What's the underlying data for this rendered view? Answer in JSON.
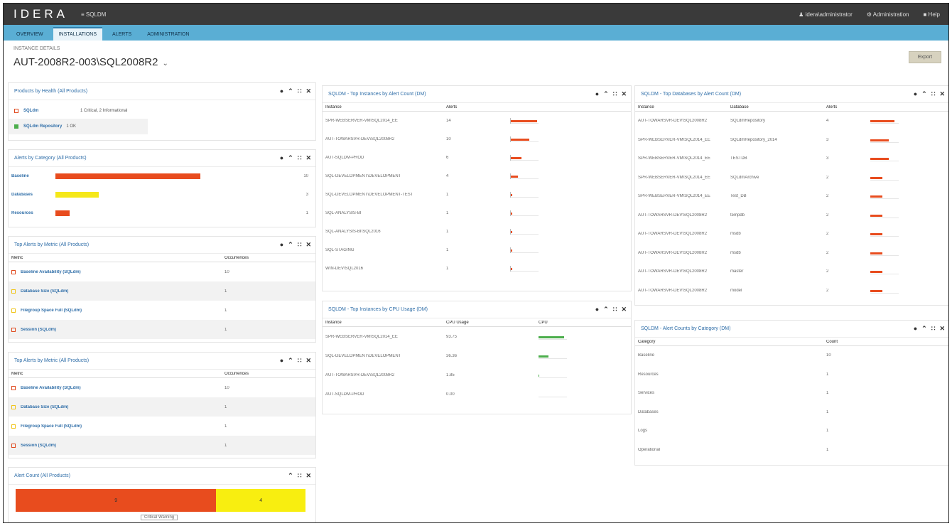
{
  "topbar": {
    "logo": "IDERA",
    "app_selector": "≡ SQLDM",
    "user": "idera\\administrator",
    "admin": "Administration",
    "help": "Help"
  },
  "nav": {
    "tabs": [
      "OVERVIEW",
      "INSTALLATIONS",
      "ALERTS",
      "ADMINISTRATION"
    ],
    "active": 1
  },
  "header": {
    "breadcrumb": "INSTANCE DETAILS",
    "title": "AUT-2008R2-003\\SQL2008R2",
    "export_label": "Export"
  },
  "panels": {
    "health": {
      "title": "Products by Health (All Products)",
      "items": [
        {
          "name": "SQLdm",
          "text": "1 Critical, 2 Informational",
          "color": "#e04a1f"
        },
        {
          "name": "SQLdm Repository",
          "text": "1 OK",
          "color": "#4cae4c"
        }
      ]
    },
    "alerts_cat": {
      "title": "Alerts by Category (All Products)",
      "rows": [
        {
          "label": "Baseline",
          "value": 10,
          "color": "#e84c1e"
        },
        {
          "label": "Databases",
          "value": 3,
          "color": "#f5e81a"
        },
        {
          "label": "Resources",
          "value": 1,
          "color": "#e84c1e"
        }
      ]
    },
    "top_severity": {
      "title": "Top Alerts by Metric (All Products)",
      "headers": [
        "Metric",
        "Occurrences"
      ],
      "rows": [
        {
          "metric": "Baseline Availability (SQLdm)",
          "count": "10",
          "color": "#e04a1f"
        },
        {
          "metric": "Database Size (SQLdm)",
          "count": "1",
          "color": "#f0c419"
        },
        {
          "metric": "Filegroup Space Full (SQLdm)",
          "count": "1",
          "color": "#f0c419"
        },
        {
          "metric": "Session (SQLdm)",
          "count": "1",
          "color": "#e04a1f"
        }
      ]
    },
    "top_metric": {
      "title": "Top Alerts by Metric (All Products)",
      "headers": [
        "Metric",
        "Occurrences"
      ],
      "rows": [
        {
          "metric": "Baseline Availability (SQLdm)",
          "count": "10",
          "color": "#e04a1f"
        },
        {
          "metric": "Database Size (SQLdm)",
          "count": "1",
          "color": "#f0c419"
        },
        {
          "metric": "Filegroup Space Full (SQLdm)",
          "count": "1",
          "color": "#f0c419"
        },
        {
          "metric": "Session (SQLdm)",
          "count": "1",
          "color": "#e04a1f"
        }
      ]
    },
    "alert_count": {
      "title": "Alert Count (All Products)",
      "segments": [
        {
          "label": "9",
          "value": 9,
          "color": "#e84c1e"
        },
        {
          "label": "4",
          "value": 4,
          "color": "#f8ee10"
        }
      ],
      "legend": "Critical  Warning"
    },
    "top_instances_alert": {
      "title": "SQLDM - Top Instances by Alert Count (DM)",
      "headers": [
        "Instance",
        "Alerts"
      ],
      "rows": [
        {
          "name": "SPR-WEBSERVER-VM\\SQL2014_EE",
          "count": "14",
          "value": 14
        },
        {
          "name": "AUT-TOWARSVR-DEV\\SQL2008R2",
          "count": "10",
          "value": 10
        },
        {
          "name": "AUT-SQLDM-PROD",
          "count": "6",
          "value": 6
        },
        {
          "name": "SQL-DEVELOPMENT\\DEVELOPMENT",
          "count": "4",
          "value": 4
        },
        {
          "name": "SQL-DEVELOPMENT\\DEVELOPMENT-TEST",
          "count": "1",
          "value": 1
        },
        {
          "name": "SQL-ANALYSIS-BI",
          "count": "1",
          "value": 1
        },
        {
          "name": "SQL-ANALYSIS-BI\\SQL2016",
          "count": "1",
          "value": 1
        },
        {
          "name": "SQL-STAGING",
          "count": "1",
          "value": 1
        },
        {
          "name": "WIN-DEV\\SQL2016",
          "count": "1",
          "value": 1
        }
      ]
    },
    "top_instances_cpu": {
      "title": "SQLDM - Top Instances by CPU Usage (DM)",
      "headers": [
        "Instance",
        "CPU Usage",
        "CPU"
      ],
      "rows": [
        {
          "name": "SPR-WEBSERVER-VM\\SQL2014_EE",
          "usage": "93.75",
          "value": 93.75
        },
        {
          "name": "SQL-DEVELOPMENT\\DEVELOPMENT",
          "usage": "36.36",
          "value": 36.36
        },
        {
          "name": "AUT-TOWARSVR-DEV\\SQL2008R2",
          "usage": "1.85",
          "value": 1.85
        },
        {
          "name": "AUT-SQLDM-PROD",
          "usage": "0.00",
          "value": 0
        }
      ]
    },
    "top_dbs": {
      "title": "SQLDM - Top Databases by Alert Count (DM)",
      "headers": [
        "Instance",
        "Database",
        "Alerts"
      ],
      "rows": [
        {
          "instance": "AUT-TOWARSVR-DEV\\SQL2008R2",
          "db": "SQLdmRepository",
          "count": "4",
          "value": 4
        },
        {
          "instance": "SPR-WEBSERVER-VM\\SQL2014_EE",
          "db": "SQLdmRepository_2014",
          "count": "3",
          "value": 3
        },
        {
          "instance": "SPR-WEBSERVER-VM\\SQL2014_EE",
          "db": "TESTDB",
          "count": "3",
          "value": 3
        },
        {
          "instance": "SPR-WEBSERVER-VM\\SQL2014_EE",
          "db": "SQLdmArchive",
          "count": "2",
          "value": 2
        },
        {
          "instance": "SPR-WEBSERVER-VM\\SQL2014_EE",
          "db": "Test_DB",
          "count": "2",
          "value": 2
        },
        {
          "instance": "AUT-TOWARSVR-DEV\\SQL2008R2",
          "db": "tempdb",
          "count": "2",
          "value": 2
        },
        {
          "instance": "AUT-TOWARSVR-DEV\\SQL2008R2",
          "db": "msdb",
          "count": "2",
          "value": 2
        },
        {
          "instance": "AUT-TOWARSVR-DEV\\SQL2008R2",
          "db": "msdb",
          "count": "2",
          "value": 2
        },
        {
          "instance": "AUT-TOWARSVR-DEV\\SQL2008R2",
          "db": "master",
          "count": "2",
          "value": 2
        },
        {
          "instance": "AUT-TOWARSVR-DEV\\SQL2008R2",
          "db": "model",
          "count": "2",
          "value": 2
        }
      ]
    },
    "alerts_by_cat": {
      "title": "SQLDM - Alert Counts by Category (DM)",
      "headers": [
        "Category",
        "Count"
      ],
      "rows": [
        {
          "cat": "Baseline",
          "count": "10"
        },
        {
          "cat": "Resources",
          "count": "1"
        },
        {
          "cat": "Services",
          "count": "1"
        },
        {
          "cat": "Databases",
          "count": "1"
        },
        {
          "cat": "Logs",
          "count": "1"
        },
        {
          "cat": "Operational",
          "count": "1"
        }
      ]
    }
  },
  "colors": {
    "topbar": "#3a3a3a",
    "nav": "#5aaed4",
    "critical": "#e84c1e",
    "warning": "#f5e81a",
    "ok": "#4cae4c",
    "link": "#2f6ea8"
  }
}
